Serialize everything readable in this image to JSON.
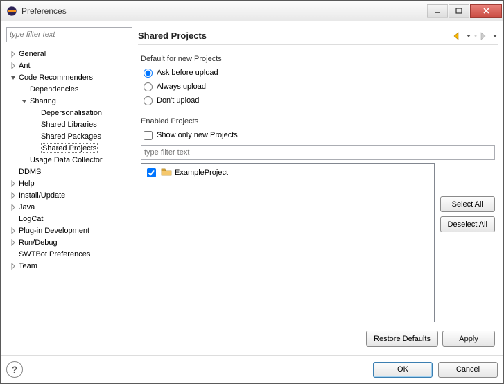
{
  "window": {
    "title": "Preferences"
  },
  "filter": {
    "placeholder": "type filter text"
  },
  "tree": [
    {
      "label": "General",
      "depth": 0,
      "expander": "collapsed"
    },
    {
      "label": "Ant",
      "depth": 0,
      "expander": "collapsed"
    },
    {
      "label": "Code Recommenders",
      "depth": 0,
      "expander": "expanded"
    },
    {
      "label": "Dependencies",
      "depth": 1,
      "expander": "none"
    },
    {
      "label": "Sharing",
      "depth": 1,
      "expander": "expanded"
    },
    {
      "label": "Depersonalisation",
      "depth": 2,
      "expander": "none"
    },
    {
      "label": "Shared Libraries",
      "depth": 2,
      "expander": "none"
    },
    {
      "label": "Shared Packages",
      "depth": 2,
      "expander": "none"
    },
    {
      "label": "Shared Projects",
      "depth": 2,
      "expander": "none",
      "selected": true
    },
    {
      "label": "Usage Data Collector",
      "depth": 1,
      "expander": "none"
    },
    {
      "label": "DDMS",
      "depth": 0,
      "expander": "none"
    },
    {
      "label": "Help",
      "depth": 0,
      "expander": "collapsed"
    },
    {
      "label": "Install/Update",
      "depth": 0,
      "expander": "collapsed"
    },
    {
      "label": "Java",
      "depth": 0,
      "expander": "collapsed"
    },
    {
      "label": "LogCat",
      "depth": 0,
      "expander": "none"
    },
    {
      "label": "Plug-in Development",
      "depth": 0,
      "expander": "collapsed"
    },
    {
      "label": "Run/Debug",
      "depth": 0,
      "expander": "collapsed"
    },
    {
      "label": "SWTBot Preferences",
      "depth": 0,
      "expander": "none"
    },
    {
      "label": "Team",
      "depth": 0,
      "expander": "collapsed"
    }
  ],
  "page": {
    "title": "Shared Projects",
    "default_group": "Default for new Projects",
    "radios": {
      "ask": "Ask before upload",
      "always": "Always upload",
      "dont": "Don't upload"
    },
    "enabled_group": "Enabled Projects",
    "show_only_new": "Show only new Projects",
    "filter_placeholder": "type filter text",
    "project_list": [
      {
        "name": "ExampleProject",
        "checked": true
      }
    ]
  },
  "buttons": {
    "select_all": "Select All",
    "deselect_all": "Deselect All",
    "restore_defaults": "Restore Defaults",
    "apply": "Apply",
    "ok": "OK",
    "cancel": "Cancel"
  }
}
